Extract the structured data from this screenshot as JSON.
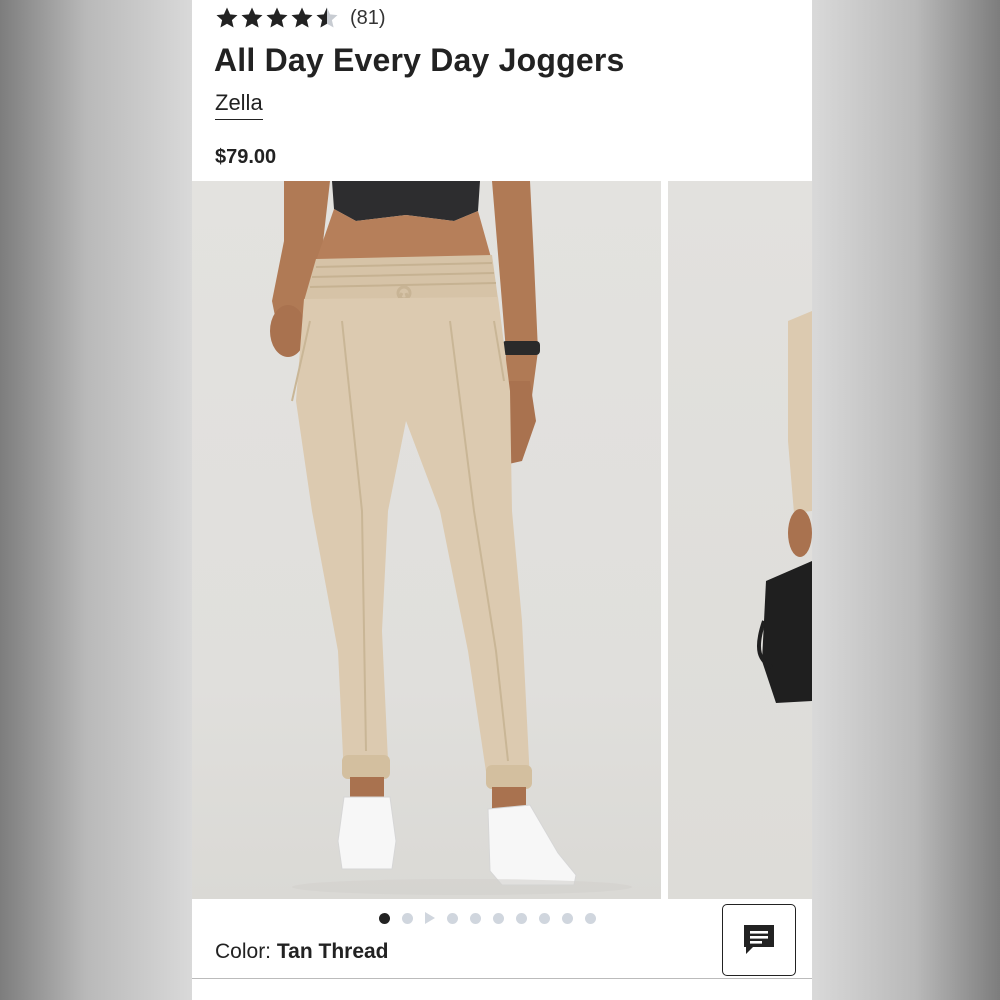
{
  "product": {
    "rating": {
      "value": 4.5,
      "max": 5,
      "count_label": "(81)"
    },
    "title": "All Day Every Day Joggers",
    "brand": "Zella",
    "price": "$79.00",
    "color": {
      "label": "Color:",
      "value": "Tan Thread"
    }
  },
  "gallery": {
    "image_count": 10,
    "active_index": 0,
    "video_indicator_index": 2
  },
  "icons": {
    "star": "star-icon",
    "chat": "chat-icon",
    "play": "play-icon"
  },
  "colors": {
    "text": "#222222",
    "dot_inactive": "#d0d6de",
    "dot_active": "#222222",
    "star_filled": "#222222",
    "star_empty": "#c8ccd2",
    "pants": "#dccab0"
  }
}
